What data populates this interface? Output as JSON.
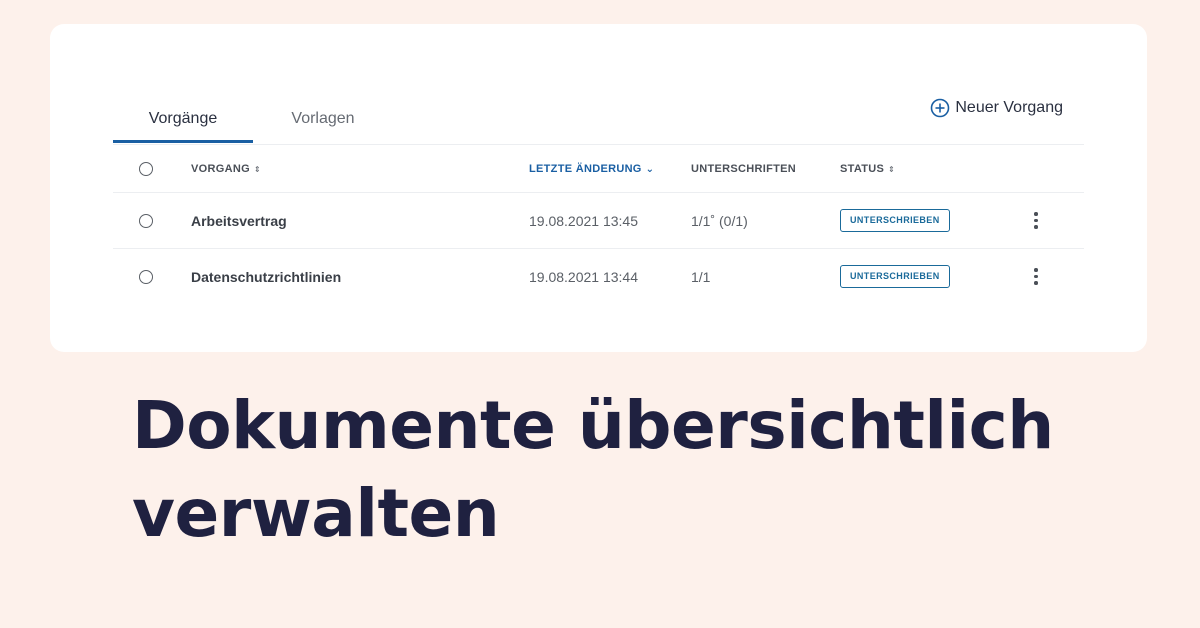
{
  "tabs": {
    "vorgaenge": "Vorgänge",
    "vorlagen": "Vorlagen"
  },
  "new_button": {
    "label": "Neuer Vorgang",
    "icon": "plus-circle-icon"
  },
  "table": {
    "columns": {
      "vorgang": "VORGANG",
      "last_change": "LETZTE ÄNDERUNG",
      "signatures": "UNTERSCHRIFTEN",
      "status": "STATUS"
    },
    "sort_asc_desc_icon": "⇕",
    "sort_desc_icon": "⌄",
    "rows": [
      {
        "name": "Arbeitsvertrag",
        "date": "19.08.2021 13:45",
        "signatures": "1/1˚ (0/1)",
        "status": "UNTERSCHRIEBEN"
      },
      {
        "name": "Datenschutzrichtlinien",
        "date": "19.08.2021 13:44",
        "signatures": "1/1",
        "status": "UNTERSCHRIEBEN"
      }
    ]
  },
  "headline": {
    "line1": "Dokumente übersichtlich",
    "line2": "verwalten"
  },
  "colors": {
    "background": "#fdf1eb",
    "accent": "#1a5fa3",
    "headline": "#1f2140"
  }
}
